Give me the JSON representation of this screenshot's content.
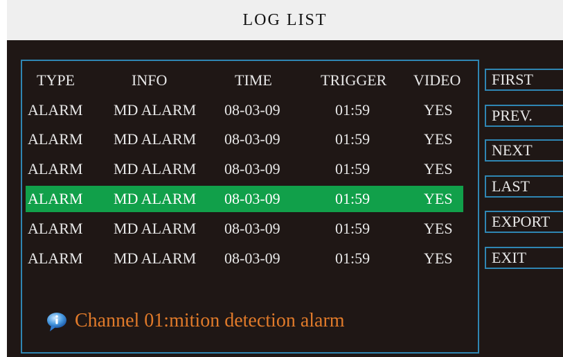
{
  "title": "LOG LIST",
  "columns": [
    "TYPE",
    "INFO",
    "TIME",
    "TRIGGER",
    "VIDEO"
  ],
  "rows": [
    {
      "type": "ALARM",
      "info": "MD ALARM",
      "time": "08-03-09",
      "trigger": "01:59",
      "video": "YES"
    },
    {
      "type": "ALARM",
      "info": "MD ALARM",
      "time": "08-03-09",
      "trigger": "01:59",
      "video": "YES"
    },
    {
      "type": "ALARM",
      "info": "MD ALARM",
      "time": "08-03-09",
      "trigger": "01:59",
      "video": "YES"
    },
    {
      "type": "ALARM",
      "info": "MD ALARM",
      "time": "08-03-09",
      "trigger": "01:59",
      "video": "YES"
    },
    {
      "type": "ALARM",
      "info": "MD ALARM",
      "time": "08-03-09",
      "trigger": "01:59",
      "video": "YES"
    },
    {
      "type": "ALARM",
      "info": "MD ALARM",
      "time": "08-03-09",
      "trigger": "01:59",
      "video": "YES"
    }
  ],
  "selected_row": 3,
  "buttons": {
    "first": "FIRST",
    "prev": "PREV.",
    "next": "NEXT",
    "last": "LAST",
    "export": "EXPORT",
    "exit": "EXIT"
  },
  "status": {
    "icon": "info-icon",
    "message": "Channel 01:mition detection alarm"
  },
  "colors": {
    "background": "#1f1715",
    "border": "#2f86b3",
    "selected_row": "#11a04a",
    "status_text": "#e07a2a",
    "title_bar": "#efefef"
  }
}
